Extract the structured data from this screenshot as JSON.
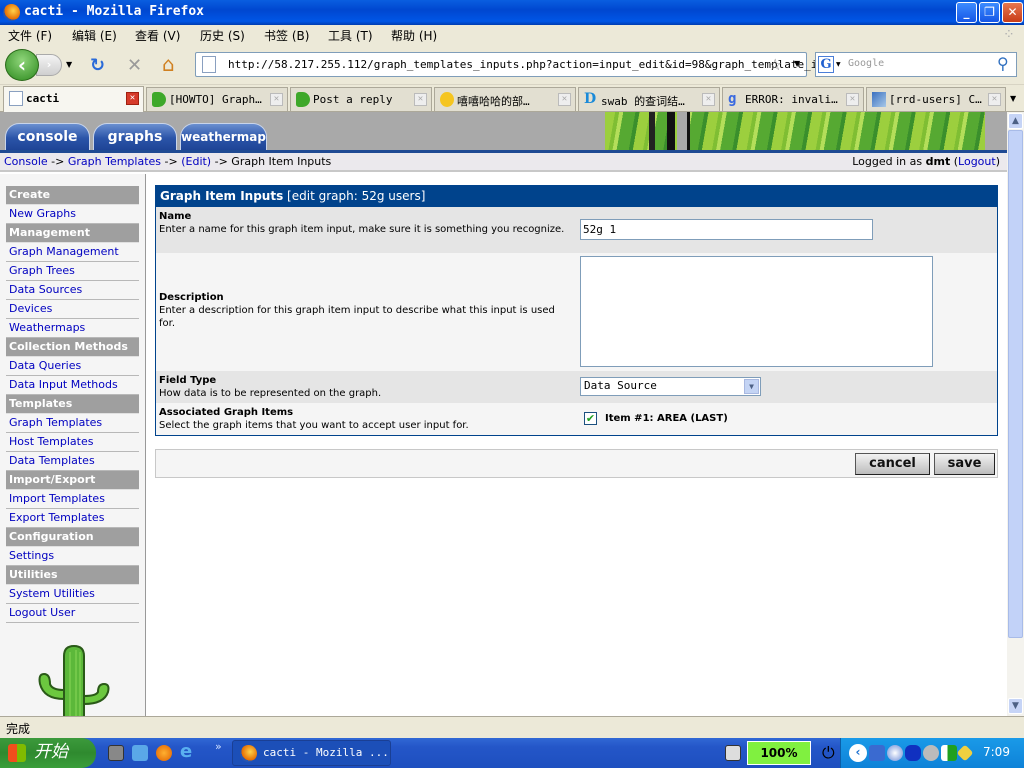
{
  "window": {
    "title": "cacti - Mozilla Firefox",
    "controls": {
      "minimize": "_",
      "restore": "❐",
      "close": "✕"
    }
  },
  "menu": {
    "items": [
      "文件 (F)",
      "编辑 (E)",
      "查看 (V)",
      "历史 (S)",
      "书签 (B)",
      "工具 (T)",
      "帮助 (H)"
    ]
  },
  "nav": {
    "url": "http://58.217.255.112/graph_templates_inputs.php?action=input_edit&id=98&graph_template_i",
    "search_placeholder": "Google",
    "icons": {
      "back": "‹",
      "forward": "›",
      "reload": "↻",
      "stop": "✕",
      "home": "⌂",
      "star": "☆",
      "search": "⚲"
    }
  },
  "browser_tabs": [
    {
      "label": "cacti",
      "active": true
    },
    {
      "label": "[HOWTO] Graph…",
      "active": false
    },
    {
      "label": "Post a reply",
      "active": false
    },
    {
      "label": "嘻嘻哈哈的部…",
      "active": false
    },
    {
      "label": "swab 的查词结…",
      "active": false
    },
    {
      "label": "ERROR: invali…",
      "active": false
    },
    {
      "label": "[rrd-users] C…",
      "active": false
    }
  ],
  "cacti": {
    "top_tabs": [
      "console",
      "graphs",
      "weathermap"
    ],
    "breadcrumb": {
      "console": "Console",
      "sep": "->",
      "graph_templates": "Graph Templates",
      "edit": "(Edit)",
      "current": "Graph Item Inputs"
    },
    "login": {
      "prefix": "Logged in as",
      "user": "dmt",
      "logout": "Logout"
    },
    "sidebar": [
      {
        "type": "header",
        "label": "Create"
      },
      {
        "type": "item",
        "label": "New Graphs"
      },
      {
        "type": "header",
        "label": "Management"
      },
      {
        "type": "item",
        "label": "Graph Management"
      },
      {
        "type": "item",
        "label": "Graph Trees"
      },
      {
        "type": "item",
        "label": "Data Sources"
      },
      {
        "type": "item",
        "label": "Devices"
      },
      {
        "type": "item",
        "label": "Weathermaps"
      },
      {
        "type": "header",
        "label": "Collection Methods"
      },
      {
        "type": "item",
        "label": "Data Queries"
      },
      {
        "type": "item",
        "label": "Data Input Methods"
      },
      {
        "type": "header",
        "label": "Templates"
      },
      {
        "type": "item",
        "label": "Graph Templates"
      },
      {
        "type": "item",
        "label": "Host Templates"
      },
      {
        "type": "item",
        "label": "Data Templates"
      },
      {
        "type": "header",
        "label": "Import/Export"
      },
      {
        "type": "item",
        "label": "Import Templates"
      },
      {
        "type": "item",
        "label": "Export Templates"
      },
      {
        "type": "header",
        "label": "Configuration"
      },
      {
        "type": "item",
        "label": "Settings"
      },
      {
        "type": "header",
        "label": "Utilities"
      },
      {
        "type": "item",
        "label": "System Utilities"
      },
      {
        "type": "item",
        "label": "Logout User"
      }
    ],
    "form": {
      "title": "Graph Item Inputs",
      "subtitle": "[edit graph: 52g users]",
      "name": {
        "label": "Name",
        "help": "Enter a name for this graph item input, make sure it is something you recognize.",
        "value": "52g 1"
      },
      "description": {
        "label": "Description",
        "help": "Enter a description for this graph item input to describe what this input is used for.",
        "value": ""
      },
      "field_type": {
        "label": "Field Type",
        "help": "How data is to be represented on the graph.",
        "selected": "Data Source"
      },
      "associated": {
        "label": "Associated Graph Items",
        "help": "Select the graph items that you want to accept user input for.",
        "items": [
          {
            "label": "Item #1: AREA (LAST)",
            "checked": true
          }
        ]
      }
    },
    "buttons": {
      "cancel": "cancel",
      "save": "save"
    }
  },
  "status": {
    "text": "完成"
  },
  "taskbar": {
    "start": "开始",
    "window_button": "cacti - Mozilla ...",
    "battery": "100%",
    "clock": "7:09",
    "more": "»"
  }
}
